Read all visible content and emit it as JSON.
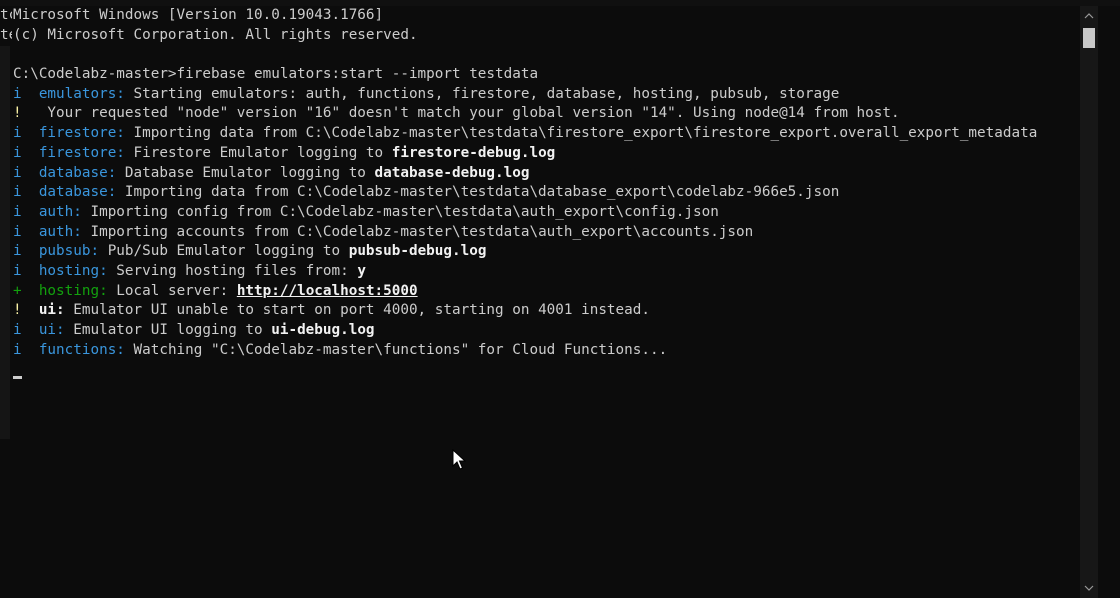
{
  "edge_text": [
    "tc",
    "te"
  ],
  "lines": [
    {
      "marker": "",
      "marker_type": "",
      "name": "",
      "name_type": "",
      "parts": [
        {
          "t": "Microsoft Windows [Version 10.0.19043.1766]",
          "s": "txt"
        }
      ]
    },
    {
      "marker": "",
      "marker_type": "",
      "name": "",
      "name_type": "",
      "parts": [
        {
          "t": "(c) Microsoft Corporation. All rights reserved.",
          "s": "txt"
        }
      ]
    },
    {
      "marker": "",
      "marker_type": "",
      "name": "",
      "name_type": "",
      "parts": []
    },
    {
      "marker": "",
      "marker_type": "",
      "name": "",
      "name_type": "",
      "parts": [
        {
          "t": "C:\\Codelabz-master>firebase emulators:start --import testdata",
          "s": "txt"
        }
      ]
    },
    {
      "marker": "i",
      "marker_type": "mk",
      "name": "emulators:",
      "name_type": "nm",
      "parts": [
        {
          "t": " Starting emulators: auth, functions, firestore, database, hosting, pubsub, storage",
          "s": "txt"
        }
      ]
    },
    {
      "marker": "!",
      "marker_type": "mk-warn",
      "name": "",
      "name_type": "",
      "parts": [
        {
          "t": " Your requested \"node\" version \"16\" doesn't match your global version \"14\". Using node@14 from host.",
          "s": "txt"
        }
      ]
    },
    {
      "marker": "i",
      "marker_type": "mk",
      "name": "firestore:",
      "name_type": "nm",
      "parts": [
        {
          "t": " Importing data from C:\\Codelabz-master\\testdata\\firestore_export\\firestore_export.overall_export_metadata",
          "s": "txt"
        }
      ]
    },
    {
      "marker": "i",
      "marker_type": "mk",
      "name": "firestore:",
      "name_type": "nm",
      "parts": [
        {
          "t": " Firestore Emulator logging to ",
          "s": "txt"
        },
        {
          "t": "firestore-debug.log",
          "s": "bold"
        }
      ]
    },
    {
      "marker": "i",
      "marker_type": "mk",
      "name": "database:",
      "name_type": "nm",
      "parts": [
        {
          "t": " Database Emulator logging to ",
          "s": "txt"
        },
        {
          "t": "database-debug.log",
          "s": "bold"
        }
      ]
    },
    {
      "marker": "i",
      "marker_type": "mk",
      "name": "database:",
      "name_type": "nm",
      "parts": [
        {
          "t": " Importing data from C:\\Codelabz-master\\testdata\\database_export\\codelabz-966e5.json",
          "s": "txt"
        }
      ]
    },
    {
      "marker": "i",
      "marker_type": "mk",
      "name": "auth:",
      "name_type": "nm",
      "parts": [
        {
          "t": " Importing config from C:\\Codelabz-master\\testdata\\auth_export\\config.json",
          "s": "txt"
        }
      ]
    },
    {
      "marker": "i",
      "marker_type": "mk",
      "name": "auth:",
      "name_type": "nm",
      "parts": [
        {
          "t": " Importing accounts from C:\\Codelabz-master\\testdata\\auth_export\\accounts.json",
          "s": "txt"
        }
      ]
    },
    {
      "marker": "i",
      "marker_type": "mk",
      "name": "pubsub:",
      "name_type": "nm",
      "parts": [
        {
          "t": " Pub/Sub Emulator logging to ",
          "s": "txt"
        },
        {
          "t": "pubsub-debug.log",
          "s": "bold"
        }
      ]
    },
    {
      "marker": "i",
      "marker_type": "mk",
      "name": "hosting:",
      "name_type": "nm",
      "parts": [
        {
          "t": " Serving hosting files from: ",
          "s": "txt"
        },
        {
          "t": "y",
          "s": "bold"
        }
      ]
    },
    {
      "marker": "+",
      "marker_type": "mk-ok",
      "name": "hosting:",
      "name_type": "nm-ok",
      "parts": [
        {
          "t": " Local server: ",
          "s": "txt"
        },
        {
          "t": "http://localhost:5000",
          "s": "url"
        }
      ]
    },
    {
      "marker": "!",
      "marker_type": "mk-warn",
      "name": "ui:",
      "name_type": "bold",
      "parts": [
        {
          "t": " Emulator UI unable to start on port 4000, starting on 4001 instead.",
          "s": "txt"
        }
      ]
    },
    {
      "marker": "i",
      "marker_type": "mk",
      "name": "ui:",
      "name_type": "nm",
      "parts": [
        {
          "t": " Emulator UI logging to ",
          "s": "txt"
        },
        {
          "t": "ui-debug.log",
          "s": "bold"
        }
      ]
    },
    {
      "marker": "i",
      "marker_type": "mk",
      "name": "functions:",
      "name_type": "nm",
      "parts": [
        {
          "t": " Watching \"C:\\Codelabz-master\\functions\" for Cloud Functions...",
          "s": "txt"
        }
      ]
    }
  ],
  "colors": {
    "background": "#0c0c0c",
    "foreground": "#cccccc",
    "info": "#3a96dd",
    "warn": "#f9f1a5",
    "success": "#13a10e",
    "bright": "#f2f2f2"
  },
  "icons": {
    "scroll_up": "chevron-up-icon",
    "scroll_down": "chevron-down-icon",
    "pointer": "mouse-pointer-icon"
  }
}
